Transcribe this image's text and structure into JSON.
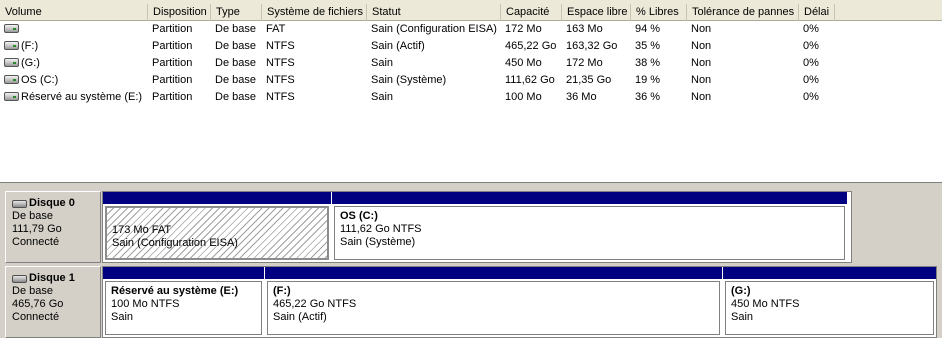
{
  "columns": [
    "Volume",
    "Disposition",
    "Type",
    "Système de fichiers",
    "Statut",
    "Capacité",
    "Espace libre",
    "% Libres",
    "Tolérance de pannes",
    "Délai"
  ],
  "volumes": [
    {
      "name": "",
      "disposition": "Partition",
      "type": "De base",
      "fs": "FAT",
      "status": "Sain (Configuration EISA)",
      "capacity": "172 Mo",
      "free": "163 Mo",
      "pct": "94 %",
      "fault": "Non",
      "overhead": "0%"
    },
    {
      "name": "(F:)",
      "disposition": "Partition",
      "type": "De base",
      "fs": "NTFS",
      "status": "Sain (Actif)",
      "capacity": "465,22 Go",
      "free": "163,32 Go",
      "pct": "35 %",
      "fault": "Non",
      "overhead": "0%"
    },
    {
      "name": "(G:)",
      "disposition": "Partition",
      "type": "De base",
      "fs": "NTFS",
      "status": "Sain",
      "capacity": "450 Mo",
      "free": "172 Mo",
      "pct": "38 %",
      "fault": "Non",
      "overhead": "0%"
    },
    {
      "name": "OS (C:)",
      "disposition": "Partition",
      "type": "De base",
      "fs": "NTFS",
      "status": "Sain (Système)",
      "capacity": "111,62 Go",
      "free": "21,35 Go",
      "pct": "19 %",
      "fault": "Non",
      "overhead": "0%"
    },
    {
      "name": "Réservé au système (E:)",
      "disposition": "Partition",
      "type": "De base",
      "fs": "NTFS",
      "status": "Sain",
      "capacity": "100 Mo",
      "free": "36 Mo",
      "pct": "36 %",
      "fault": "Non",
      "overhead": "0%"
    }
  ],
  "disks": [
    {
      "name": "Disque 0",
      "type": "De base",
      "size": "111,79 Go",
      "state": "Connecté",
      "partitions": [
        {
          "name": "",
          "info": "173 Mo FAT",
          "status": "Sain (Configuration EISA)",
          "selected": true
        },
        {
          "name": "OS  (C:)",
          "info": "111,62 Go NTFS",
          "status": "Sain (Système)",
          "selected": false
        }
      ]
    },
    {
      "name": "Disque 1",
      "type": "De base",
      "size": "465,76 Go",
      "state": "Connecté",
      "partitions": [
        {
          "name": "Réservé au système  (E:)",
          "info": "100 Mo NTFS",
          "status": "Sain",
          "selected": false
        },
        {
          "name": "(F:)",
          "info": "465,22 Go NTFS",
          "status": "Sain (Actif)",
          "selected": false
        },
        {
          "name": "(G:)",
          "info": "450 Mo NTFS",
          "status": "Sain",
          "selected": false
        }
      ]
    }
  ],
  "colors": {
    "partition_bar": "#000080",
    "header_bg": "#ece9d8"
  },
  "icons": {
    "volume": "drive-icon",
    "disk": "disk-icon"
  }
}
